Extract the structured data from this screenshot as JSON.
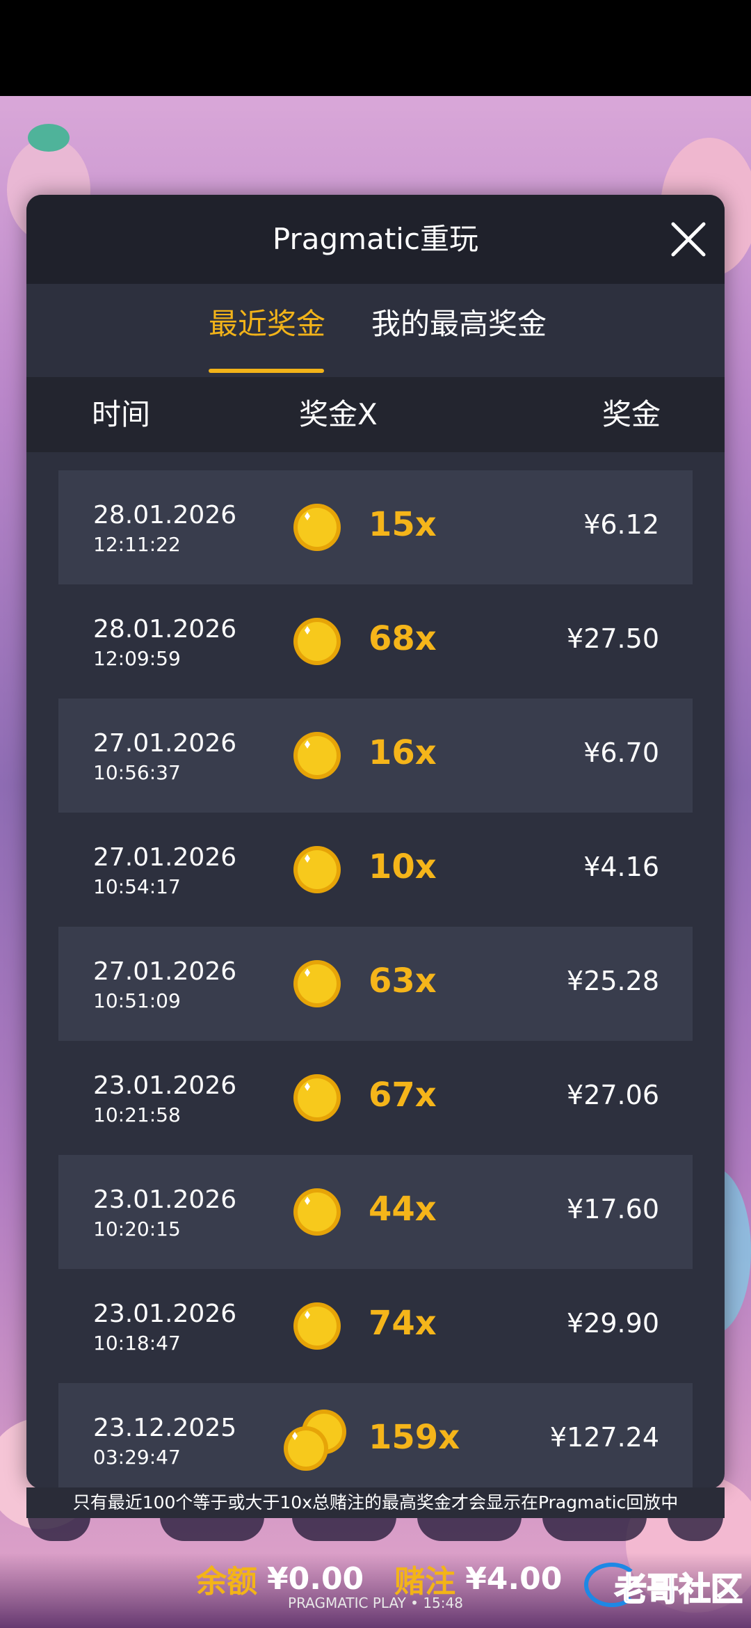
{
  "modal": {
    "title": "Pragmatic重玩",
    "tabs": [
      {
        "label": "最近奖金",
        "active": true
      },
      {
        "label": "我的最高奖金",
        "active": false
      }
    ],
    "columns": {
      "time": "时间",
      "multiplier": "奖金X",
      "win": "奖金"
    },
    "rows": [
      {
        "date": "28.01.2026",
        "time": "12:11:22",
        "multiplier": "15x",
        "amount": "¥6.12",
        "coins": 1
      },
      {
        "date": "28.01.2026",
        "time": "12:09:59",
        "multiplier": "68x",
        "amount": "¥27.50",
        "coins": 1
      },
      {
        "date": "27.01.2026",
        "time": "10:56:37",
        "multiplier": "16x",
        "amount": "¥6.70",
        "coins": 1
      },
      {
        "date": "27.01.2026",
        "time": "10:54:17",
        "multiplier": "10x",
        "amount": "¥4.16",
        "coins": 1
      },
      {
        "date": "27.01.2026",
        "time": "10:51:09",
        "multiplier": "63x",
        "amount": "¥25.28",
        "coins": 1
      },
      {
        "date": "23.01.2026",
        "time": "10:21:58",
        "multiplier": "67x",
        "amount": "¥27.06",
        "coins": 1
      },
      {
        "date": "23.01.2026",
        "time": "10:20:15",
        "multiplier": "44x",
        "amount": "¥17.60",
        "coins": 1
      },
      {
        "date": "23.01.2026",
        "time": "10:18:47",
        "multiplier": "74x",
        "amount": "¥29.90",
        "coins": 1
      },
      {
        "date": "23.12.2025",
        "time": "03:29:47",
        "multiplier": "159x",
        "amount": "¥127.24",
        "coins": 2
      }
    ],
    "disclaimer": "只有最近100个等于或大于10x总赌注的最高奖金才会显示在Pragmatic回放中"
  },
  "footer": {
    "balance_label": "余额",
    "balance_value": "¥0.00",
    "bet_label": "赌注",
    "bet_value": "¥4.00",
    "provider_line": "PRAGMATIC PLAY • 15:48",
    "watermark": "老哥社区"
  },
  "colors": {
    "accent": "#f2b319",
    "modal_bg": "#2d303e",
    "header_bg": "#1f212b",
    "row_bg": "#393d4d"
  },
  "icons": {
    "close": "close-icon",
    "coin": "gold-coin-icon"
  }
}
